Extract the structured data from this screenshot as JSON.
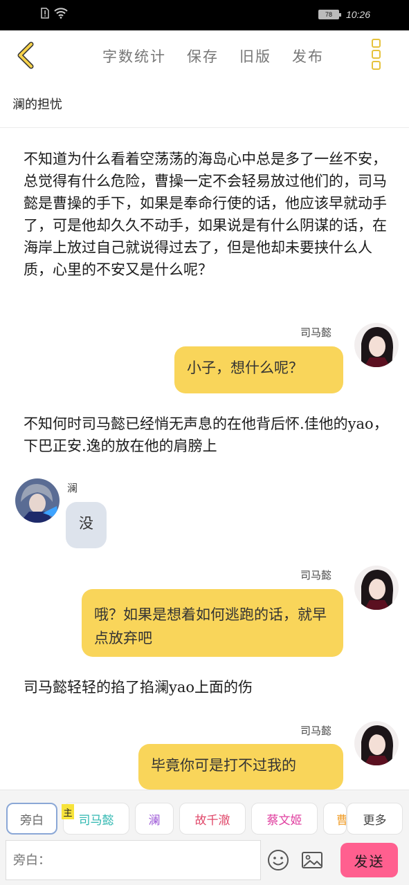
{
  "status_bar": {
    "battery": "78",
    "time": "10:26"
  },
  "toolbar": {
    "word_count": "字数统计",
    "save": "保存",
    "old_version": "旧版",
    "publish": "发布",
    "accent_color": "#e6c23c"
  },
  "chapter_title": "澜的担忧",
  "story": {
    "narration_1": "不知道为什么看着空荡荡的海岛心中总是多了一丝不安，总觉得有什么危险，曹操一定不会轻易放过他们的，司马懿是曹操的手下，如果是奉命行使的话，他应该早就动手了，可是他却久久不动手，如果说是有什么阴谋的话，在海岸上放过自己就说得过去了，但是他却未要挟什么人质，心里的不安又是什么呢？",
    "msg_1": {
      "speaker": "司马懿",
      "text": "小子，想什么呢？"
    },
    "narration_2": "不知何时司马懿已经悄无声息的在他背后怀.佳他的yao，下巴正安.逸的放在他的肩膀上",
    "msg_2": {
      "speaker": "澜",
      "text": "没"
    },
    "msg_3": {
      "speaker": "司马懿",
      "text": "哦？如果是想着如何逃跑的话，就早点放弃吧"
    },
    "narration_3": "司马懿轻轻的掐了掐澜yao上面的伤",
    "msg_4": {
      "speaker": "司马懿",
      "text": "毕竟你可是打不过我的"
    }
  },
  "bottom": {
    "roles": [
      "旁白",
      "司马懿",
      "澜",
      "故千澈",
      "蔡文姬",
      "曹"
    ],
    "host_badge": "主",
    "more": "更多",
    "input_placeholder": "旁白：",
    "send": "发送",
    "send_color": "#ff5f8f"
  }
}
